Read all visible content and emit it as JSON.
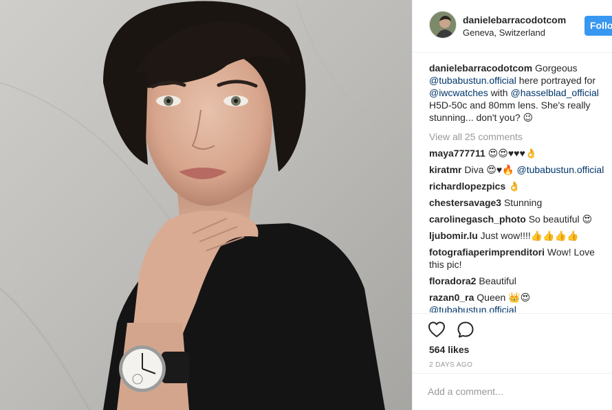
{
  "header": {
    "username": "danielebarracodotcom",
    "location": "Geneva, Switzerland",
    "follow_label": "Follo"
  },
  "caption": {
    "username": "danielebarracodotcom",
    "text_1": "Gorgeous",
    "mention_1": "@tubabustun.official",
    "text_2": "here portrayed for",
    "mention_2": "@iwcwatches",
    "text_3": "with",
    "mention_3": "@hasselblad_official",
    "text_4": "H5D-50c and 80mm lens. She's really stunning... don't you? 😉"
  },
  "view_all_label": "View all 25 comments",
  "comments": [
    {
      "user": "maya777711",
      "text": "😍😍♥♥♥👌",
      "mention": ""
    },
    {
      "user": "kiratmr",
      "text": "Diva 😍♥🔥",
      "mention": "@tubabustun.official"
    },
    {
      "user": "richardlopezpics",
      "text": "👌",
      "mention": ""
    },
    {
      "user": "chestersavage3",
      "text": "Stunning",
      "mention": ""
    },
    {
      "user": "carolinegasch_photo",
      "text": "So beautiful 😍",
      "mention": ""
    },
    {
      "user": "ljubomir.lu",
      "text": "Just wow!!!!👍👍👍👍",
      "mention": ""
    },
    {
      "user": "fotografiaperimprenditori",
      "text": "Wow! Love this pic!",
      "mention": ""
    },
    {
      "user": "floradora2",
      "text": "Beautiful",
      "mention": ""
    },
    {
      "user": "razan0_ra",
      "text": "Queen 👑😍",
      "mention": "@tubabustun.official"
    }
  ],
  "actions": {
    "like_icon": "heart-icon",
    "comment_icon": "comment-bubble-icon",
    "likes": "564 likes",
    "timestamp": "2 DAYS AGO"
  },
  "add_comment": {
    "placeholder": "Add a comment..."
  },
  "colors": {
    "accent": "#3897f0",
    "mention": "#003569",
    "muted": "#999999",
    "border": "#efefef"
  }
}
